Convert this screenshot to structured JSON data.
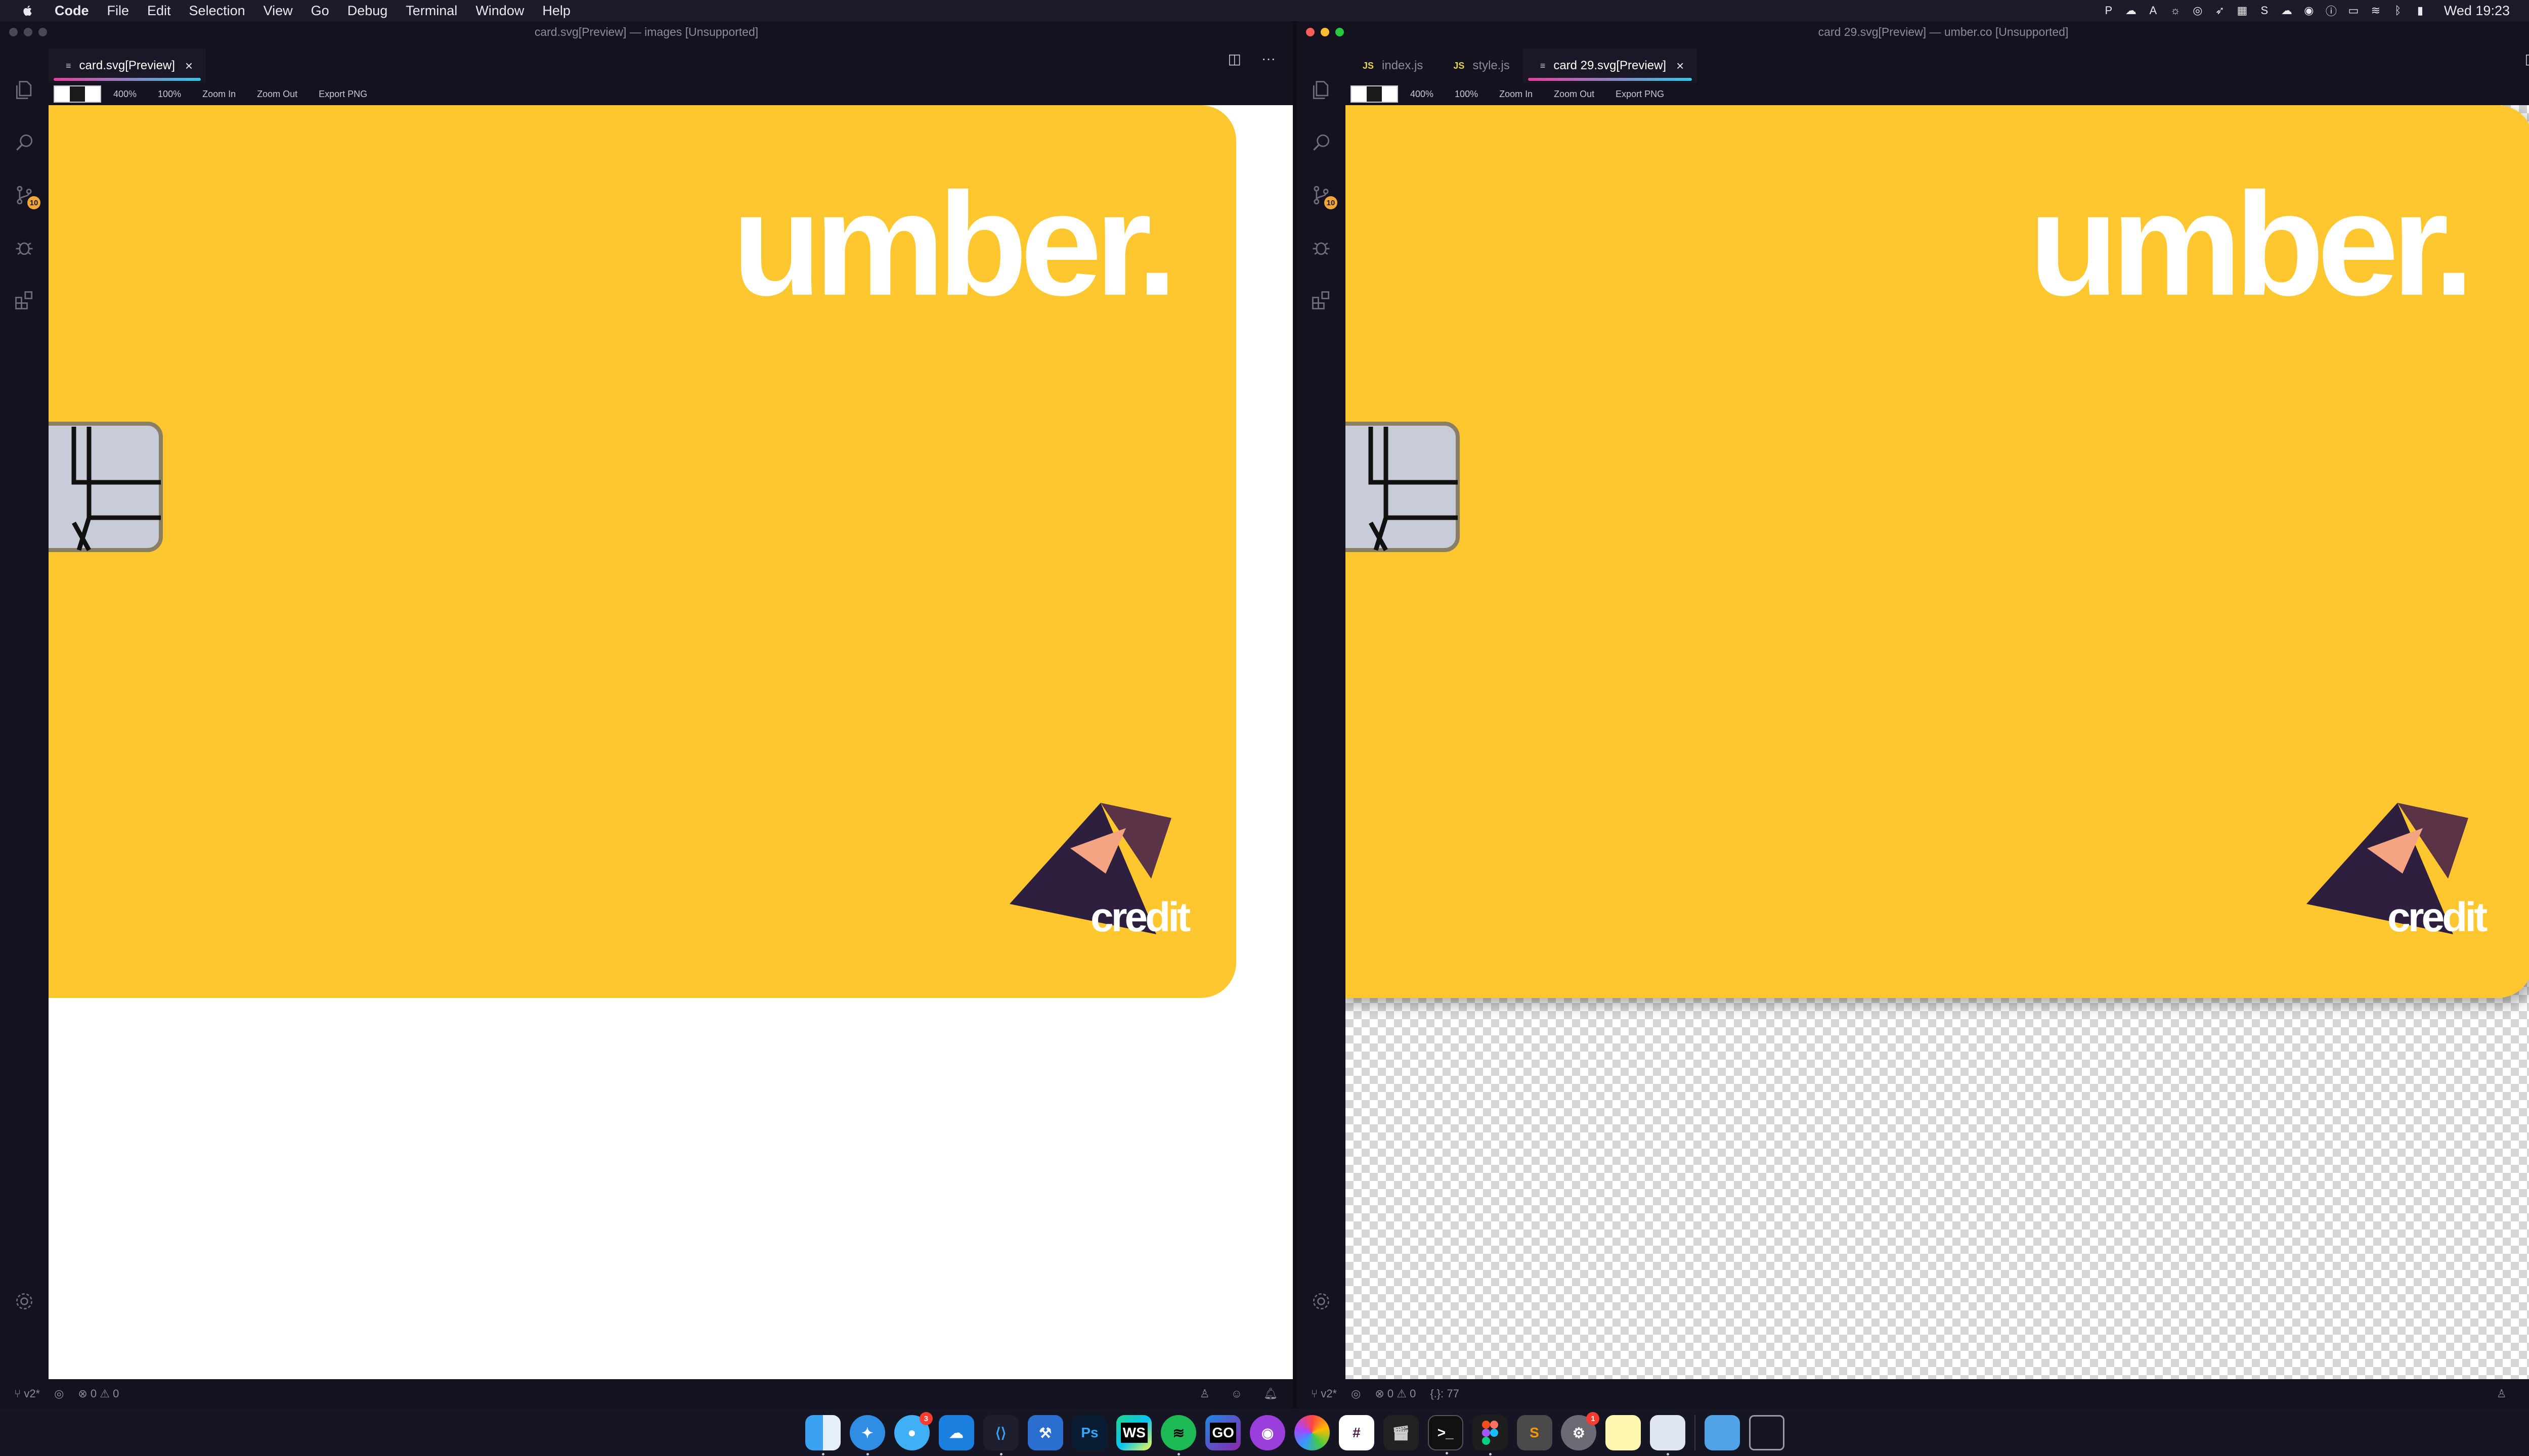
{
  "menubar": {
    "app": "Code",
    "items": [
      "File",
      "Edit",
      "Selection",
      "View",
      "Go",
      "Debug",
      "Terminal",
      "Window",
      "Help"
    ],
    "clock": "Wed 19:23"
  },
  "left_window": {
    "title": "card.svg[Preview] — images [Unsupported]",
    "tab": {
      "label": "card.svg[Preview]"
    },
    "preview_bar": {
      "zoom_small": "400%",
      "zoom": "100%",
      "zoom_in": "Zoom In",
      "zoom_out": "Zoom Out",
      "export": "Export PNG"
    },
    "status": {
      "branch": "v2*",
      "problems": "0",
      "warnings": "0"
    }
  },
  "right_window": {
    "title": "card 29.svg[Preview] — umber.co [Unsupported]",
    "tabs": [
      {
        "label": "index.js",
        "icon": "JS"
      },
      {
        "label": "style.js",
        "icon": "JS"
      },
      {
        "label": "card 29.svg[Preview]",
        "icon": "≡"
      }
    ],
    "preview_bar": {
      "zoom_small": "400%",
      "zoom": "100%",
      "zoom_in": "Zoom In",
      "zoom_out": "Zoom Out",
      "export": "Export PNG"
    },
    "status": {
      "branch": "v2*",
      "problems": "0",
      "warnings": "0",
      "selection": "{.}: 77"
    }
  },
  "card": {
    "brand": "umber.",
    "badge_text": "credit",
    "colors": {
      "card": "#ffc72f",
      "logo_dark": "#2d1f3d",
      "logo_mid": "#5a3346",
      "logo_peach": "#f4a482",
      "chip": "#c8ccd8"
    }
  },
  "activity_badge": "10",
  "dock": {
    "apps": [
      "finder-icon",
      "safari-icon",
      "messages-icon",
      "cloud-icon",
      "vscode-icon",
      "xcode-icon",
      "photoshop-icon",
      "webstorm-icon",
      "spotify-icon",
      "goland-icon",
      "podcasts-icon",
      "photos-icon",
      "slack-icon",
      "final-cut-icon",
      "terminal-icon",
      "figma-icon",
      "sublime-icon",
      "system-prefs-icon",
      "notes-icon",
      "preview-icon",
      "downloads-folder-icon",
      "trash-icon"
    ],
    "labels": {
      "photoshop": "Ps",
      "webstorm": "WS",
      "goland": "GO"
    },
    "badges": {
      "messages": "3",
      "system_prefs": "1"
    }
  }
}
